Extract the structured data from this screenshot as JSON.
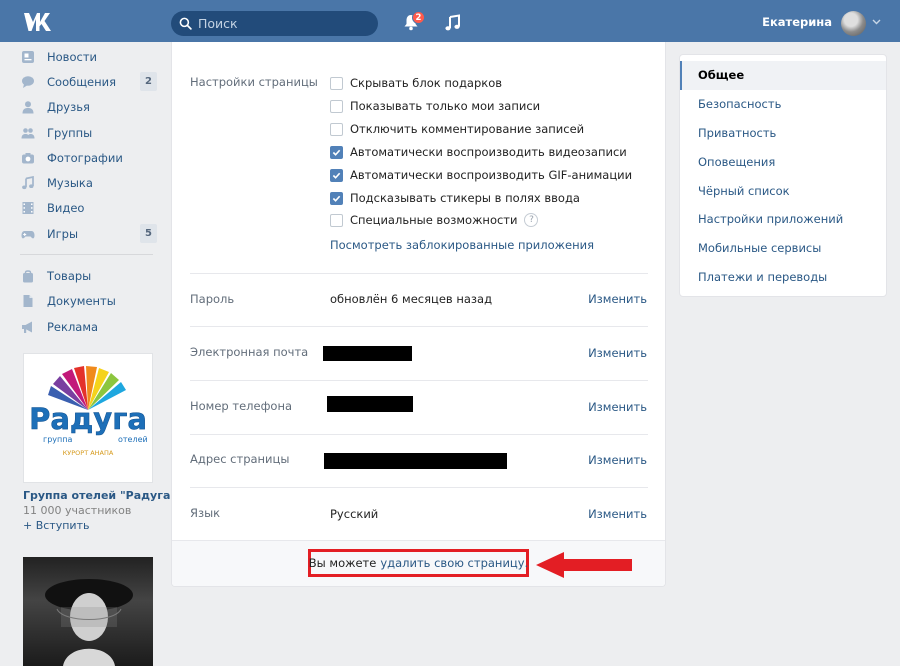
{
  "header": {
    "search_placeholder": "Поиск",
    "notifications_count": "2",
    "username": "Екатерина"
  },
  "sidebar": {
    "items": [
      {
        "label": "Новости",
        "icon": "news-icon",
        "count": ""
      },
      {
        "label": "Сообщения",
        "icon": "messages-icon",
        "count": "2"
      },
      {
        "label": "Друзья",
        "icon": "friends-icon",
        "count": ""
      },
      {
        "label": "Группы",
        "icon": "groups-icon",
        "count": ""
      },
      {
        "label": "Фотографии",
        "icon": "camera-icon",
        "count": ""
      },
      {
        "label": "Музыка",
        "icon": "music-icon",
        "count": ""
      },
      {
        "label": "Видео",
        "icon": "video-icon",
        "count": ""
      },
      {
        "label": "Игры",
        "icon": "gamepad-icon",
        "count": "5"
      }
    ],
    "items2": [
      {
        "label": "Товары",
        "icon": "bag-icon"
      },
      {
        "label": "Документы",
        "icon": "document-icon"
      },
      {
        "label": "Реклама",
        "icon": "megaphone-icon"
      }
    ],
    "ad": {
      "logo_text": "Радуга",
      "logo_left": "группа",
      "logo_right": "отелей",
      "logo_bottom": "КУРОРТ АНАПА",
      "title": "Группа отелей \"Радуга\"",
      "members": "11 000 участников",
      "join": "+ Вступить"
    }
  },
  "settings": {
    "page_settings_label": "Настройки страницы",
    "checkboxes": [
      {
        "label": "Скрывать блок подарков",
        "checked": false
      },
      {
        "label": "Показывать только мои записи",
        "checked": false
      },
      {
        "label": "Отключить комментирование записей",
        "checked": false
      },
      {
        "label": "Автоматически воспроизводить видеозаписи",
        "checked": true
      },
      {
        "label": "Автоматически воспроизводить GIF-анимации",
        "checked": true
      },
      {
        "label": "Подсказывать стикеры в полях ввода",
        "checked": true
      },
      {
        "label": "Специальные возможности",
        "checked": false
      }
    ],
    "help_glyph": "?",
    "blocked_apps_link": "Посмотреть заблокированные приложения",
    "rows": [
      {
        "label": "Пароль",
        "value": "обновлён 6 месяцев назад",
        "action": "Изменить"
      },
      {
        "label": "Электронная почта",
        "value": "",
        "action": "Изменить"
      },
      {
        "label": "Номер телефона",
        "value": "",
        "action": "Изменить"
      },
      {
        "label": "Адрес страницы",
        "value": "",
        "action": "Изменить"
      },
      {
        "label": "Язык",
        "value": "Русский",
        "action": "Изменить"
      }
    ],
    "footer": {
      "text": "Вы можете",
      "link": "удалить свою страницу."
    }
  },
  "right_menu": {
    "items": [
      {
        "label": "Общее",
        "active": true
      },
      {
        "label": "Безопасность",
        "active": false
      },
      {
        "label": "Приватность",
        "active": false
      },
      {
        "label": "Оповещения",
        "active": false
      },
      {
        "label": "Чёрный список",
        "active": false
      },
      {
        "label": "Настройки приложений",
        "active": false
      },
      {
        "label": "Мобильные сервисы",
        "active": false
      },
      {
        "label": "Платежи и переводы",
        "active": false
      }
    ]
  },
  "colors": {
    "header": "#4a76a8",
    "link": "#2a5885",
    "highlight": "#e31e24",
    "checkbox": "#5181b8"
  }
}
